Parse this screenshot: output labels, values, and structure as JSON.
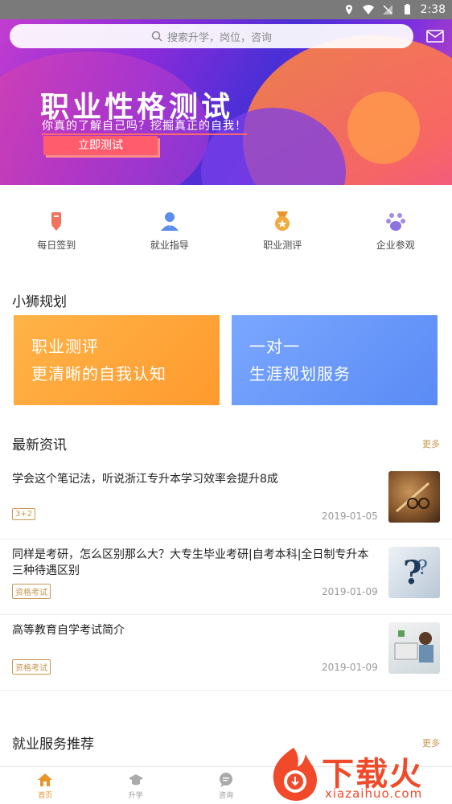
{
  "status_bar": {
    "time": "2:38"
  },
  "search": {
    "placeholder": "搜索升学，岗位，咨询"
  },
  "banner": {
    "title": "职业性格测试",
    "subtitle": "你真的了解自己吗？挖掘真正的自我！",
    "button": "立即测试"
  },
  "quick_nav": [
    {
      "label": "每日签到",
      "icon": "pen-icon"
    },
    {
      "label": "就业指导",
      "icon": "person-icon"
    },
    {
      "label": "职业测评",
      "icon": "medal-icon"
    },
    {
      "label": "企业参观",
      "icon": "group-icon"
    }
  ],
  "planning": {
    "title": "小狮规划",
    "cards": [
      {
        "line1": "职业测评",
        "line2": "更清晰的自我认知"
      },
      {
        "line1": "一对一",
        "line2": "生涯规划服务"
      }
    ]
  },
  "news": {
    "title": "最新资讯",
    "more": "更多",
    "items": [
      {
        "title": "学会这个笔记法，听说浙江专升本学习效率会提升8成",
        "tag": "3+2",
        "date": "2019-01-05"
      },
      {
        "title": "同样是考研，怎么区别那么大？大专生毕业考研|自考本科|全日制专升本三种待遇区别",
        "tag": "资格考试",
        "date": "2019-01-09"
      },
      {
        "title": "高等教育自学考试简介",
        "tag": "资格考试",
        "date": "2019-01-09"
      }
    ]
  },
  "jobs": {
    "title": "就业服务推荐",
    "more": "更多"
  },
  "tab_bar": [
    {
      "label": "首页",
      "active": true
    },
    {
      "label": "升学",
      "active": false
    },
    {
      "label": "咨询",
      "active": false
    }
  ],
  "watermark": {
    "text": "下载火",
    "url": "xiazaihuo.com"
  },
  "colors": {
    "accent": "#e8952a",
    "tag": "#c8964f"
  }
}
